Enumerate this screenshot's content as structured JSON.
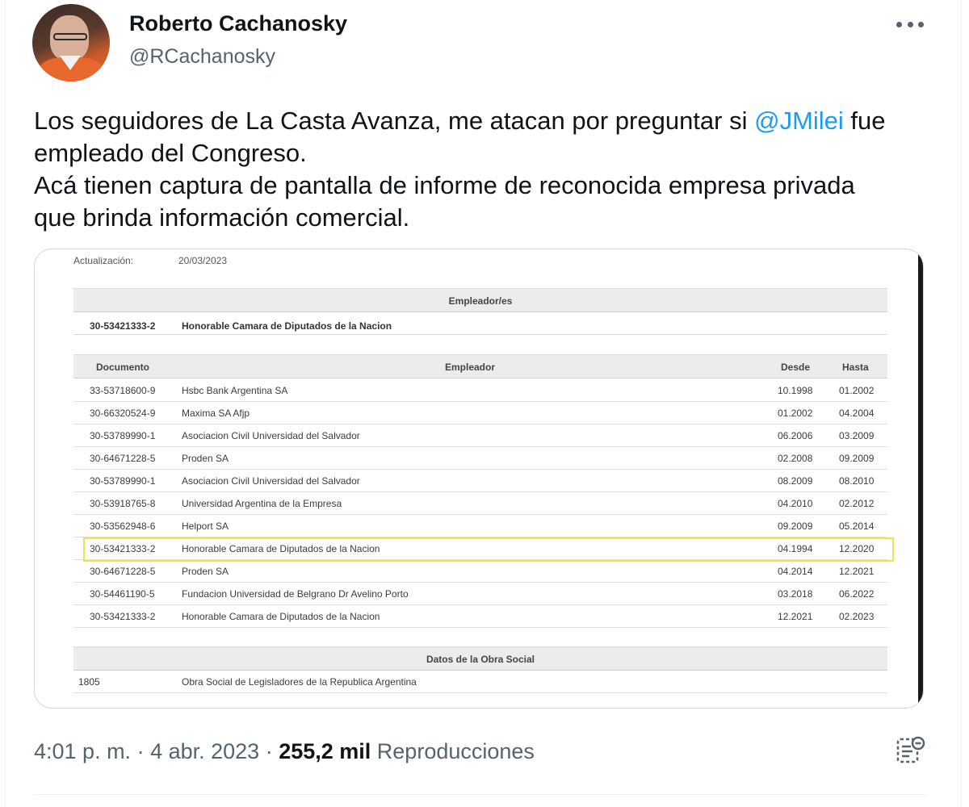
{
  "author": {
    "name": "Roberto Cachanosky",
    "handle": "@RCachanosky"
  },
  "tweet": {
    "line1_before": "Los seguidores de La Casta Avanza, me atacan por preguntar si ",
    "mention": "@JMilei",
    "line1_after": " fue",
    "line2": "empleado del Congreso.",
    "line3": "Acá tienen captura de pantalla de informe de reconocida empresa privada",
    "line4": "que brinda información comercial."
  },
  "document": {
    "update_label": "Actualización:",
    "update_value": "20/03/2023",
    "employer_header": "Empleador/es",
    "employer": {
      "document": "30-53421333-2",
      "name": "Honorable Camara de Diputados de la Nacion"
    },
    "columns": {
      "document": "Documento",
      "employer": "Empleador",
      "from": "Desde",
      "to": "Hasta"
    },
    "rows": [
      {
        "document": "33-53718600-9",
        "employer": "Hsbc Bank Argentina SA",
        "from": "10.1998",
        "to": "01.2002"
      },
      {
        "document": "30-66320524-9",
        "employer": "Maxima SA Afjp",
        "from": "01.2002",
        "to": "04.2004"
      },
      {
        "document": "30-53789990-1",
        "employer": "Asociacion Civil Universidad del Salvador",
        "from": "06.2006",
        "to": "03.2009"
      },
      {
        "document": "30-64671228-5",
        "employer": "Proden SA",
        "from": "02.2008",
        "to": "09.2009"
      },
      {
        "document": "30-53789990-1",
        "employer": "Asociacion Civil Universidad del Salvador",
        "from": "08.2009",
        "to": "08.2010"
      },
      {
        "document": "30-53918765-8",
        "employer": "Universidad Argentina de la Empresa",
        "from": "04.2010",
        "to": "02.2012"
      },
      {
        "document": "30-53562948-6",
        "employer": "Helport SA",
        "from": "09.2009",
        "to": "05.2014"
      },
      {
        "document": "30-53421333-2",
        "employer": "Honorable Camara de Diputados de la Nacion",
        "from": "04.1994",
        "to": "12.2020",
        "highlighted": true
      },
      {
        "document": "30-64671228-5",
        "employer": "Proden SA",
        "from": "04.2014",
        "to": "12.2021"
      },
      {
        "document": "30-54461190-5",
        "employer": "Fundacion Universidad de Belgrano Dr Avelino Porto",
        "from": "03.2018",
        "to": "06.2022"
      },
      {
        "document": "30-53421333-2",
        "employer": "Honorable Camara de Diputados de la Nacion",
        "from": "12.2021",
        "to": "02.2023"
      }
    ],
    "obra_social_header": "Datos de la Obra Social",
    "obra_social": {
      "code": "1805",
      "name": "Obra Social de Legisladores de la Republica Argentina"
    },
    "highlight_color": "#f0e24a"
  },
  "footer": {
    "time": "4:01 p. m.",
    "separator": " · ",
    "date": "4 abr. 2023",
    "views_count": "255,2 mil",
    "views_label": "Reproducciones"
  },
  "icons": {
    "more": "more-options-icon",
    "analytics": "analytics-icon"
  },
  "colors": {
    "link": "#1d9bf0",
    "secondary_text": "#536471",
    "primary_text": "#0f1419"
  }
}
